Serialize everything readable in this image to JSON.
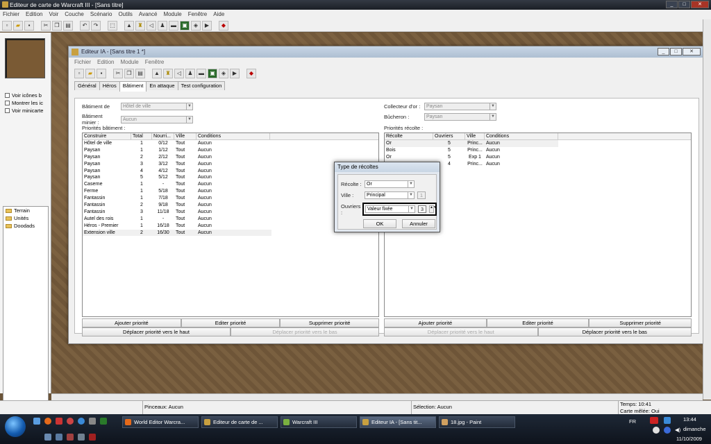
{
  "app": {
    "title": "Editeur de carte de Warcraft III - [Sans titre]"
  },
  "main_menu": [
    "Fichier",
    "Edition",
    "Voir",
    "Couche",
    "Scénario",
    "Outils",
    "Avancé",
    "Module",
    "Fenêtre",
    "Aide"
  ],
  "left_panel": {
    "checkboxes": [
      "Voir icônes b",
      "Montrer les ic",
      "Voir minicarte"
    ],
    "tree": [
      "Terrain",
      "Unités",
      "Doodads"
    ]
  },
  "ai_editor": {
    "title": "Editeur IA - [Sans titre 1 *]",
    "menu": [
      "Fichier",
      "Edition",
      "Module",
      "Fenêtre"
    ],
    "tabs": [
      "Général",
      "Héros",
      "Bâtiment",
      "En attaque",
      "Test configuration"
    ],
    "active_tab": "Bâtiment",
    "left": {
      "batiment_de_label": "Bâtiment de",
      "batiment_de_value": "Hôtel de ville",
      "batiment_minier_label": "Bâtiment minier :",
      "batiment_minier_value": "Aucun",
      "list_label": "Priorités bâtiment :",
      "headers": [
        "Construire",
        "Total",
        "Nourri...",
        "Ville",
        "Conditions"
      ],
      "rows": [
        [
          "Hôtel de ville",
          "1",
          "0/12",
          "Tout",
          "Aucun"
        ],
        [
          "Paysan",
          "1",
          "1/12",
          "Tout",
          "Aucun"
        ],
        [
          "Paysan",
          "2",
          "2/12",
          "Tout",
          "Aucun"
        ],
        [
          "Paysan",
          "3",
          "3/12",
          "Tout",
          "Aucun"
        ],
        [
          "Paysan",
          "4",
          "4/12",
          "Tout",
          "Aucun"
        ],
        [
          "Paysan",
          "5",
          "5/12",
          "Tout",
          "Aucun"
        ],
        [
          "Caserne",
          "1",
          "-",
          "Tout",
          "Aucun"
        ],
        [
          "Ferme",
          "1",
          "5/18",
          "Tout",
          "Aucun"
        ],
        [
          "Fantassin",
          "1",
          "7/18",
          "Tout",
          "Aucun"
        ],
        [
          "Fantassin",
          "2",
          "9/18",
          "Tout",
          "Aucun"
        ],
        [
          "Fantassin",
          "3",
          "11/18",
          "Tout",
          "Aucun"
        ],
        [
          "Autel des rois",
          "1",
          "-",
          "Tout",
          "Aucun"
        ],
        [
          "Héros - Premier",
          "1",
          "16/18",
          "Tout",
          "Aucun"
        ],
        [
          "Extension ville",
          "2",
          "16/30",
          "Tout",
          "Aucun"
        ]
      ],
      "buttons": [
        "Ajouter priorité",
        "Editer priorité",
        "Supprimer priorité"
      ],
      "move_up": "Déplacer priorité vers le haut",
      "move_down": "Déplacer priorité vers le bas"
    },
    "right": {
      "collecteur_label": "Collecteur d'or :",
      "collecteur_value": "Paysan",
      "bucheron_label": "Bûcheron :",
      "bucheron_value": "Paysan",
      "list_label": "Priorités récolte :",
      "headers": [
        "Récolte",
        "Ouvriers",
        "Ville",
        "Conditions"
      ],
      "rows": [
        [
          "Or",
          "5",
          "Princ...",
          "Aucun"
        ],
        [
          "Bois",
          "5",
          "Princ...",
          "Aucun"
        ],
        [
          "Or",
          "5",
          "Exp 1",
          "Aucun"
        ],
        [
          "",
          "4",
          "Princ...",
          "Aucun"
        ]
      ],
      "buttons": [
        "Ajouter priorité",
        "Editer priorité",
        "Supprimer priorité"
      ],
      "move_up": "Déplacer priorité vers le haut",
      "move_down": "Déplacer priorité vers le bas"
    }
  },
  "dialog": {
    "title": "Type de récoltes",
    "recolte_label": "Récolte :",
    "recolte_value": "Or",
    "ville_label": "Ville :",
    "ville_value": "Principal",
    "ville_num": "1",
    "ouvriers_label": "Ouvriers :",
    "ouvriers_value": "Valeur fixée",
    "ouvriers_num": "3",
    "ok": "OK",
    "cancel": "Annuler"
  },
  "status": {
    "brush": "Pinceaux: Aucun",
    "selection": "Sélection: Aucun",
    "time": "Temps: 10:41",
    "melee": "Carte mêlée: Oui"
  },
  "taskbar": {
    "tasks": [
      "World Editor Warcra...",
      "Editeur de carte de ...",
      "Warcraft III",
      "Editeur IA - [Sans tit...",
      "18.jpg - Paint"
    ],
    "lang": "FR",
    "clock_time": "13:44",
    "clock_day": "dimanche",
    "clock_date": "11/10/2009"
  }
}
